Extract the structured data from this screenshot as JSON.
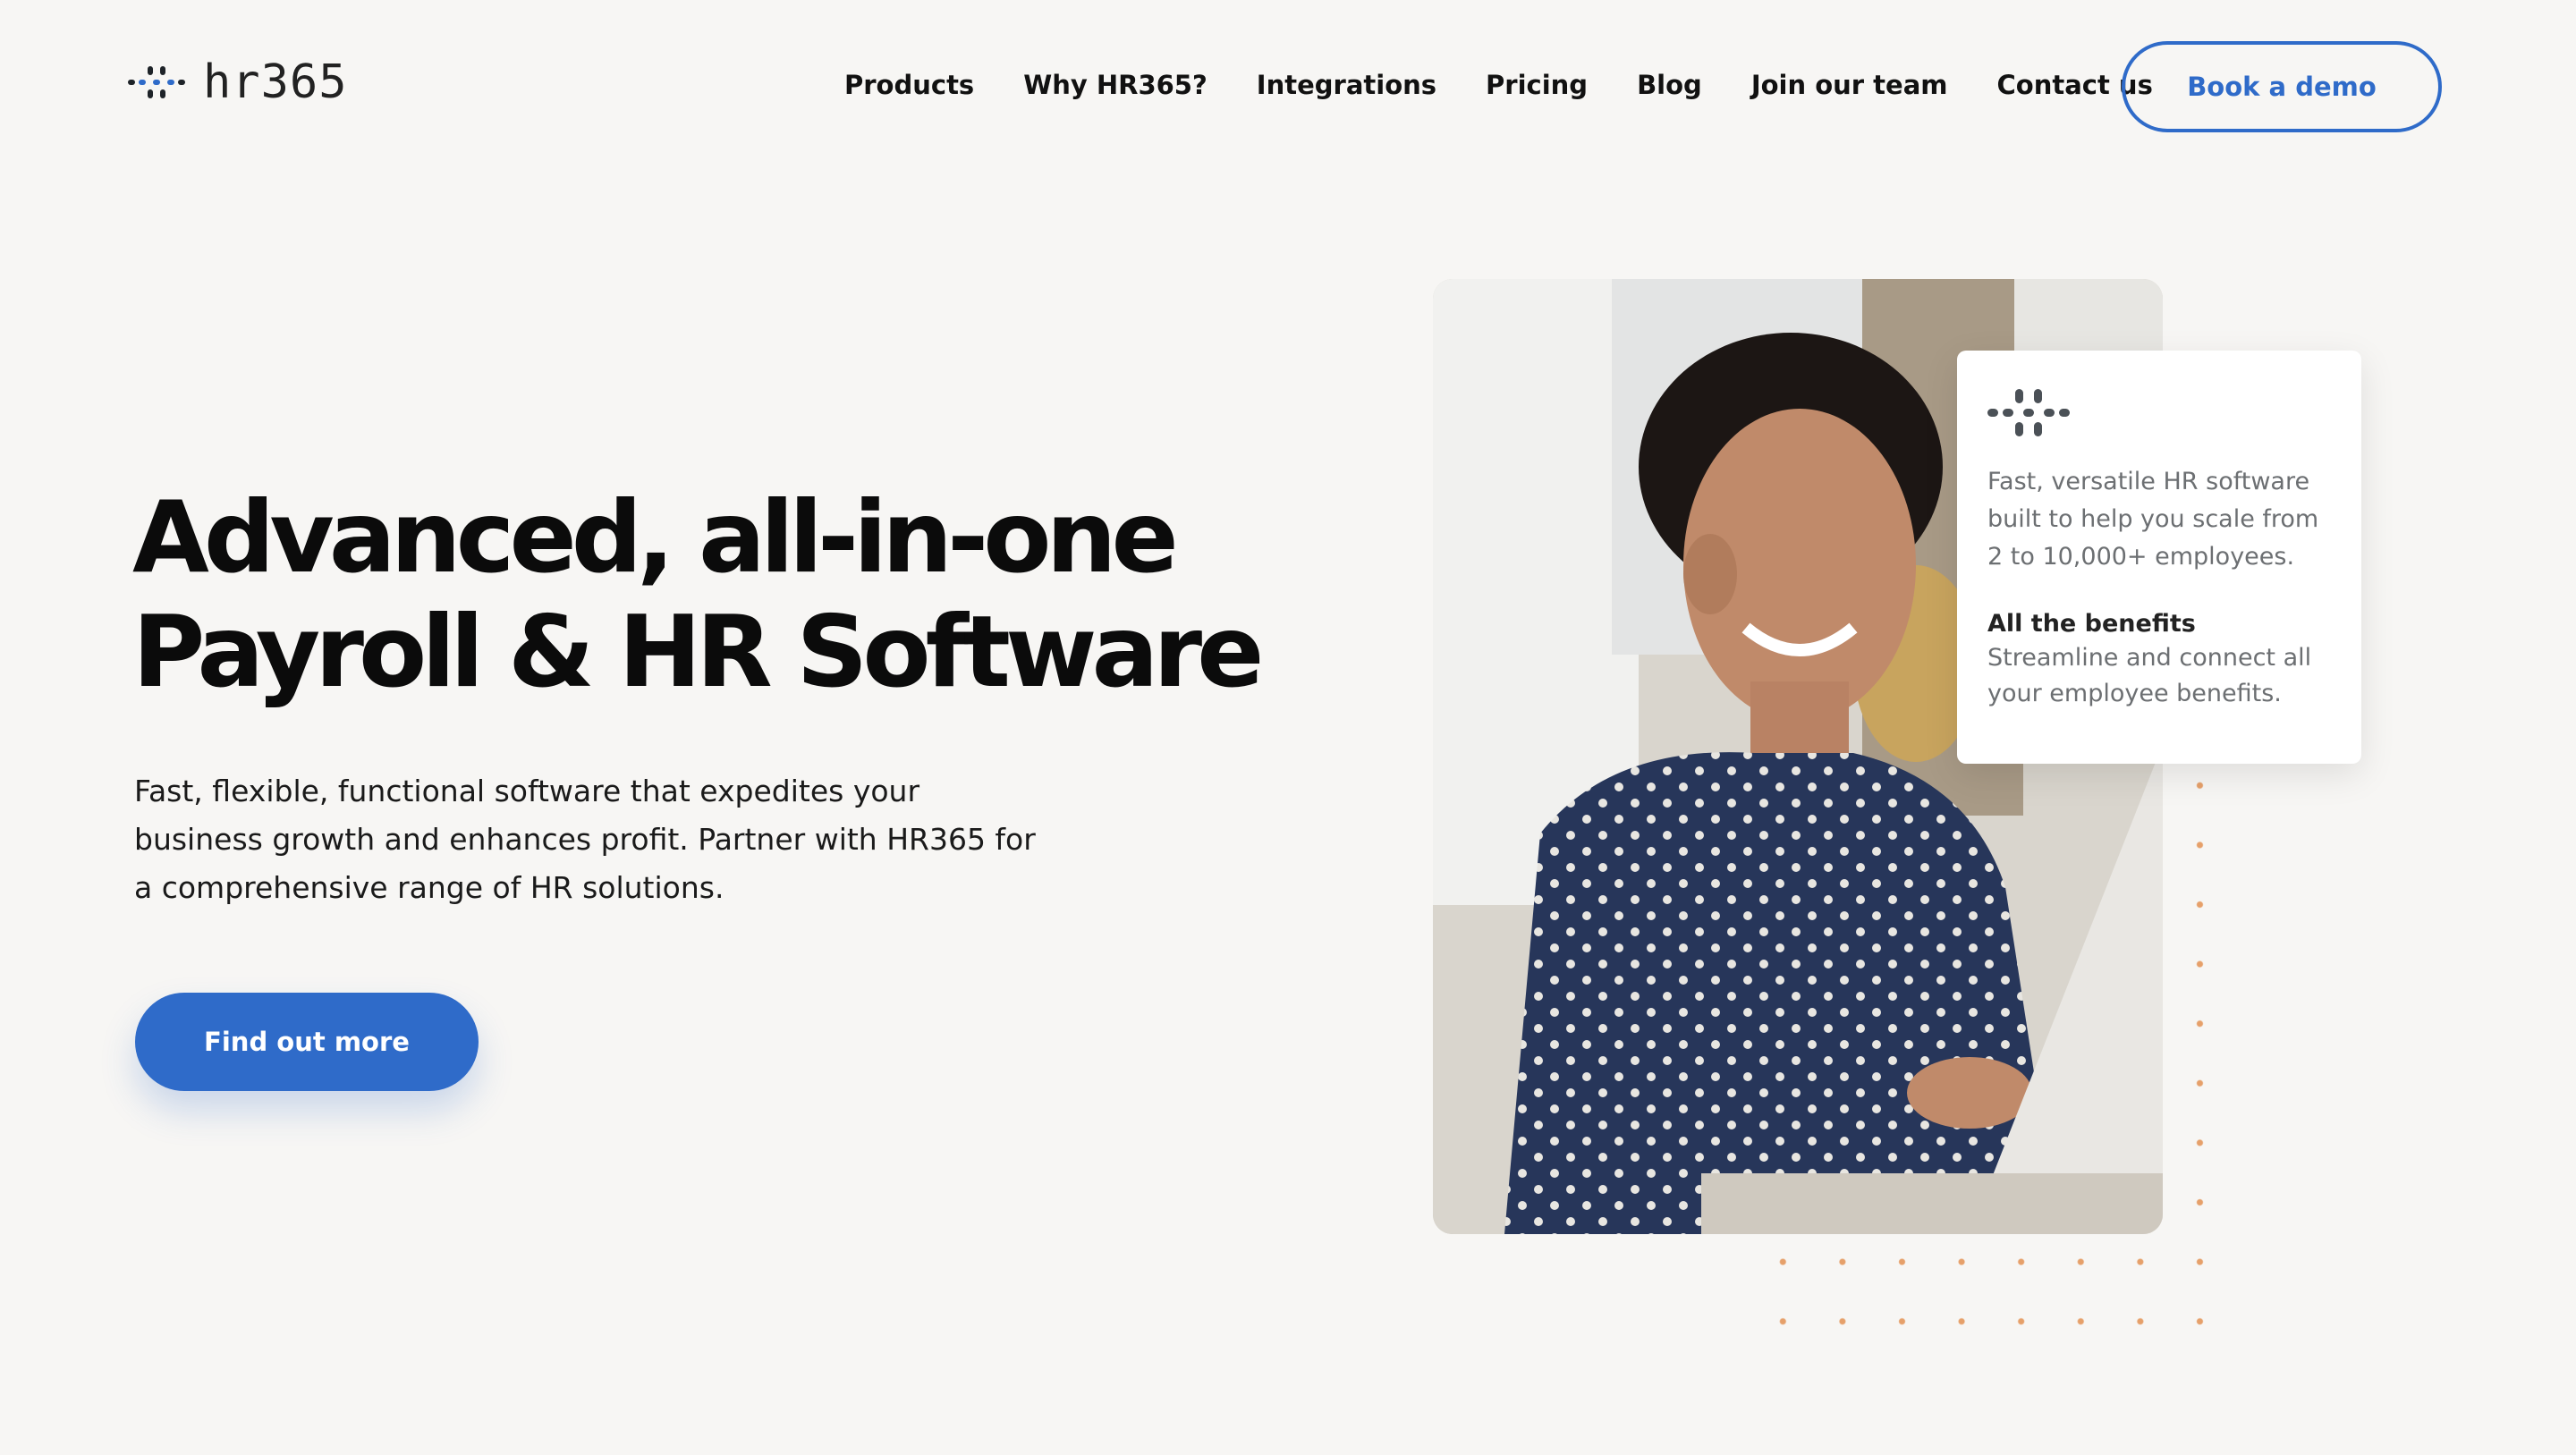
{
  "brand": {
    "logo_text": "hr365",
    "logo_icon": "hr365-logo-icon",
    "accent_color": "#2f6bc9",
    "dot_color": "#e6a06a"
  },
  "nav": {
    "items": [
      {
        "label": "Products"
      },
      {
        "label": "Why HR365?"
      },
      {
        "label": "Integrations"
      },
      {
        "label": "Pricing"
      },
      {
        "label": "Blog"
      },
      {
        "label": "Join our team"
      },
      {
        "label": "Contact us"
      }
    ],
    "demo_button": "Book a demo"
  },
  "hero": {
    "title_line1": "Advanced, all-in-one",
    "title_line2": "Payroll & HR Software",
    "description": "Fast, flexible, functional software that expedites your business growth and enhances profit. Partner with HR365 for a comprehensive range of HR solutions.",
    "cta": "Find out more"
  },
  "card": {
    "icon": "hr365-logo-icon",
    "text": "Fast, versatile HR software built to help you scale from 2 to 10,000+ employees.",
    "heading": "All the benefits",
    "subtext": "Streamline and connect all your employee benefits."
  }
}
